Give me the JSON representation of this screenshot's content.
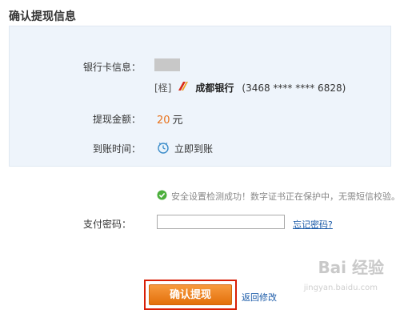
{
  "page": {
    "title": "确认提现信息"
  },
  "bank_info": {
    "label": "银行卡信息：",
    "card_tag": "[柽]",
    "bank_name": "成都银行",
    "card_number": "(3468 **** **** 6828)"
  },
  "amount": {
    "label": "提现金额：",
    "value": "20",
    "unit": "元"
  },
  "arrival": {
    "label": "到账时间：",
    "value": "立即到账",
    "icon": "clock-icon"
  },
  "security": {
    "message": "安全设置检测成功！数字证书正在保护中，无需短信校验。",
    "icon": "check-circle-icon"
  },
  "password": {
    "label": "支付密码：",
    "value": "",
    "forgot_link": "忘记密码?"
  },
  "actions": {
    "confirm_label": "确认提现",
    "back_label": "返回修改"
  },
  "watermark": {
    "text": "Bai 经验",
    "sub": "jingyan.baidu.com"
  },
  "colors": {
    "accent": "#e8721b",
    "link": "#1a5aa8",
    "highlight_border": "#d81e06",
    "panel_bg": "#eef4fb"
  }
}
